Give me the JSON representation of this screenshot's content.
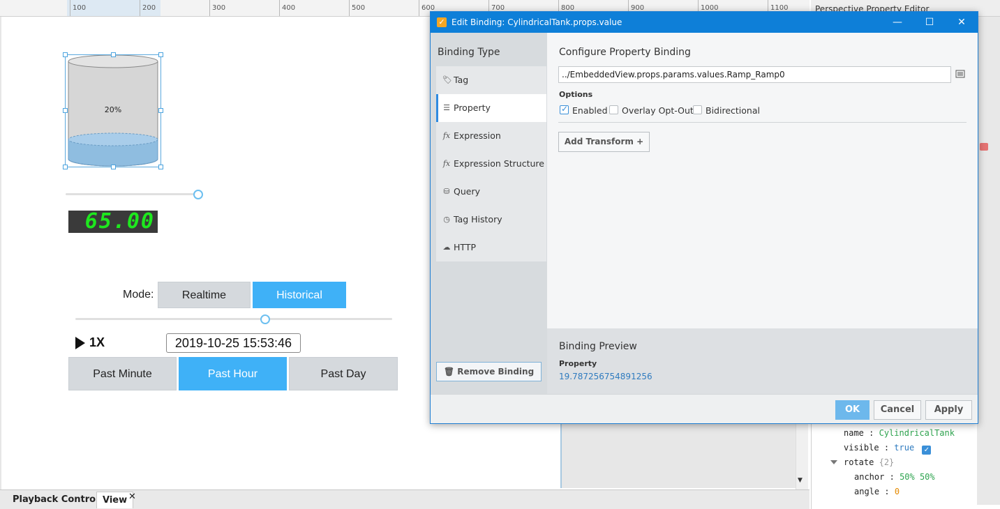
{
  "ruler": {
    "ticks": [
      "100",
      "200",
      "300",
      "400",
      "500",
      "600",
      "700",
      "800",
      "900",
      "1000",
      "1100"
    ]
  },
  "canvas": {
    "tank_label": "20%",
    "tank_fill_fraction": 0.2,
    "slider1_value_fraction": 1.0,
    "led_value": "65.00",
    "mode_label": "Mode:",
    "mode_buttons": [
      "Realtime",
      "Historical"
    ],
    "mode_selected": "Historical",
    "slider2_value_fraction": 0.6,
    "speed": "1X",
    "datetime": "2019-10-25 15:53:46",
    "range_buttons": [
      "Past Minute",
      "Past Hour",
      "Past Day"
    ],
    "range_selected": "Past Hour"
  },
  "bottom_tabs": {
    "tab1": "Playback Controller",
    "tab2": "View",
    "close": "✕"
  },
  "property_editor": {
    "title": "Perspective Property Editor",
    "rows": {
      "name_key": "name",
      "name_value": "CylindricalTank",
      "visible_key": "visible",
      "visible_value": "true",
      "rotate_key": "rotate",
      "rotate_count": "{2}",
      "anchor_key": "anchor",
      "anchor_value": "50% 50%",
      "angle_key": "angle",
      "angle_value": "0"
    },
    "sep": ":"
  },
  "dialog": {
    "title": "Edit Binding: CylindricalTank.props.value",
    "binding_type_heading": "Binding Type",
    "binding_types": [
      {
        "label": "Tag",
        "icon": "tag-icon"
      },
      {
        "label": "Property",
        "icon": "list-icon"
      },
      {
        "label": "Expression",
        "icon": "fx-icon"
      },
      {
        "label": "Expression Structure",
        "icon": "fx-icon"
      },
      {
        "label": "Query",
        "icon": "database-icon"
      },
      {
        "label": "Tag History",
        "icon": "clock-icon"
      },
      {
        "label": "HTTP",
        "icon": "cloud-icon"
      }
    ],
    "selected_type": "Property",
    "configure_title": "Configure Property Binding",
    "property_path": "../EmbeddedView.props.params.values.Ramp_Ramp0",
    "options_label": "Options",
    "options": [
      {
        "label": "Enabled",
        "checked": true
      },
      {
        "label": "Overlay Opt-Out",
        "checked": false
      },
      {
        "label": "Bidirectional",
        "checked": false
      }
    ],
    "add_transform": "Add Transform +",
    "remove_binding": "Remove Binding",
    "preview_title": "Binding Preview",
    "preview_label": "Property",
    "preview_value": "19.787256754891256",
    "buttons": {
      "ok": "OK",
      "cancel": "Cancel",
      "apply": "Apply"
    },
    "accent": "#0e7fd8"
  }
}
